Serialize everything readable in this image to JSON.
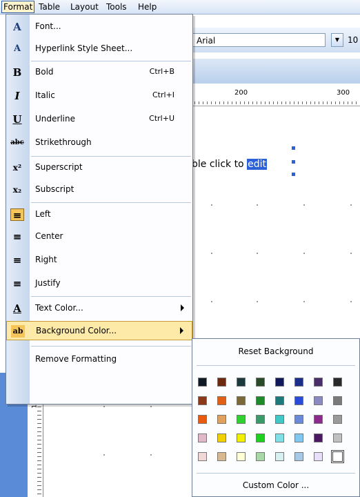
{
  "menubar": {
    "items": [
      {
        "label": "Format",
        "active": true
      },
      {
        "label": "Table"
      },
      {
        "label": "Layout"
      },
      {
        "label": "Tools"
      },
      {
        "label": "Help"
      }
    ]
  },
  "toolbar": {
    "font_name": "Arial",
    "font_size": "10"
  },
  "ruler": {
    "labels": [
      "200",
      "300"
    ]
  },
  "vertical_ruler": {
    "label": "100"
  },
  "canvas": {
    "text_before": "ble click to ",
    "selected_text": "edit"
  },
  "format_menu": {
    "items": [
      {
        "icon": "font-icon",
        "glyph": "A",
        "label": "Font..."
      },
      {
        "icon": "hyperlink-style-icon",
        "glyph": "A",
        "label": "Hyperlink Style Sheet..."
      },
      {
        "icon": "bold-icon",
        "glyph": "B",
        "label": "Bold",
        "shortcut": "Ctrl+B"
      },
      {
        "icon": "italic-icon",
        "glyph": "I",
        "label": "Italic",
        "shortcut": "Ctrl+I"
      },
      {
        "icon": "underline-icon",
        "glyph": "U",
        "label": "Underline",
        "shortcut": "Ctrl+U"
      },
      {
        "icon": "strikethrough-icon",
        "glyph": "abc",
        "label": "Strikethrough"
      },
      {
        "icon": "superscript-icon",
        "glyph": "x²",
        "label": "Superscript"
      },
      {
        "icon": "subscript-icon",
        "glyph": "x₂",
        "label": "Subscript"
      },
      {
        "icon": "align-left-icon",
        "glyph": "≡",
        "label": "Left",
        "checked": true
      },
      {
        "icon": "align-center-icon",
        "glyph": "≡",
        "label": "Center"
      },
      {
        "icon": "align-right-icon",
        "glyph": "≡",
        "label": "Right"
      },
      {
        "icon": "align-justify-icon",
        "glyph": "≡",
        "label": "Justify"
      },
      {
        "icon": "text-color-icon",
        "glyph": "A",
        "label": "Text Color...",
        "submenu": true
      },
      {
        "icon": "background-color-icon",
        "glyph": "ab",
        "label": "Background Color...",
        "submenu": true,
        "highlighted": true
      },
      {
        "icon": "",
        "glyph": "",
        "label": "Remove Formatting"
      }
    ]
  },
  "background_submenu": {
    "reset_label": "Reset Background",
    "custom_label": "Custom Color ...",
    "palette": [
      [
        "#0f1a24",
        "#6e2a10",
        "#1c3a3e",
        "#2a4a2a",
        "#101a5a",
        "#1c2e8c",
        "#4a2e6a",
        "#2a2a2a"
      ],
      [
        "#8a3a1a",
        "#e06018",
        "#7a6a3a",
        "#1e8a2a",
        "#1e7a7a",
        "#2a4ad8",
        "#8a8ac0",
        "#7a7a7a"
      ],
      [
        "#e85a10",
        "#e0a060",
        "#30d030",
        "#3a9a6a",
        "#40c8c8",
        "#6a8ad8",
        "#8a2a8a",
        "#9a9a9a"
      ],
      [
        "#e0b8c8",
        "#f0d000",
        "#f0f000",
        "#20d020",
        "#80e0e8",
        "#80c8f0",
        "#4a1a60",
        "#c0c0c0"
      ],
      [
        "#f0d8d8",
        "#d8b890",
        "#ffffd8",
        "#a8d8a8",
        "#d8f0f0",
        "#a8c8e8",
        "#e8e0f8",
        "#ffffff"
      ]
    ],
    "selected": "#ffffff"
  }
}
